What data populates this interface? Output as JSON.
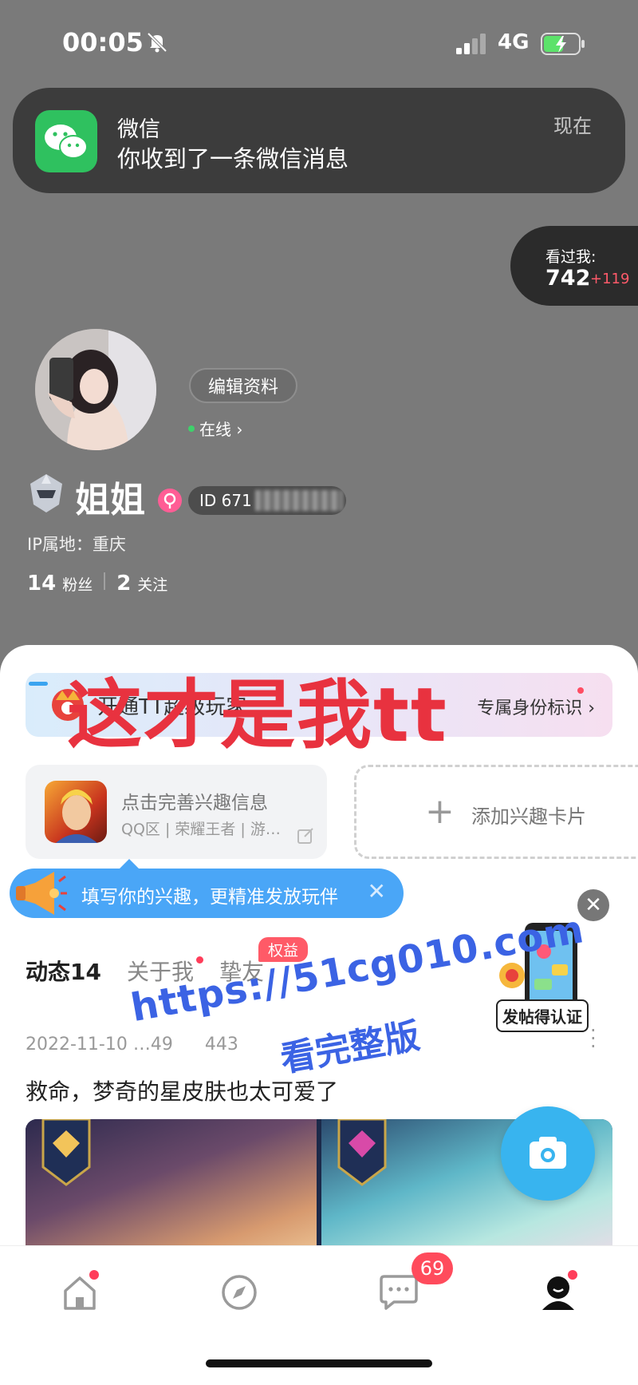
{
  "status_bar": {
    "time": "00:05",
    "network": "4G"
  },
  "notification": {
    "app": "微信",
    "message": "你收到了一条微信消息",
    "time": "现在"
  },
  "visitors": {
    "label": "看过我:",
    "count": "742",
    "delta": "+119"
  },
  "profile": {
    "edit_label": "编辑资料",
    "online_label": "在线 ›",
    "nickname": "姐姐",
    "id_prefix": "ID 671",
    "ip_location": "IP属地：重庆",
    "fans_count": "14",
    "fans_label": "粉丝",
    "following_count": "2",
    "following_label": "关注"
  },
  "banner": {
    "text": "开通TT超级玩家",
    "link": "专属身份标识 ›"
  },
  "overlay_text": {
    "headline": "这才是我tt",
    "url": "https://51cg010.com",
    "sub": "看完整版"
  },
  "interest_card": {
    "title": "点击完善兴趣信息",
    "subtitle": "QQ区 | 荣耀王者 | 游…"
  },
  "add_card": {
    "plus": "+",
    "label": "添加兴趣卡片"
  },
  "tooltip": {
    "text": "填写你的兴趣，更精准发放玩伴",
    "close": "✕"
  },
  "close_button": "✕",
  "tabs": [
    {
      "label": "动态14"
    },
    {
      "label": "关于我"
    },
    {
      "label": "挚友"
    }
  ],
  "rights_badge": "权益",
  "promo": {
    "label": "发帖得认证"
  },
  "post": {
    "date": "2022-11-10 …49",
    "views": "443",
    "title": "救命，梦奇的星皮肤也太可爱了"
  },
  "bottom_nav": {
    "message_badge": "69"
  },
  "icons": [
    "mute-icon",
    "signal-icon",
    "battery-icon",
    "wechat-icon",
    "chevron-right-icon",
    "rank-icon",
    "gender-icon",
    "crown-icon",
    "game-icon",
    "edit-icon",
    "plus-icon",
    "megaphone-icon",
    "close-icon",
    "camera-icon",
    "home-icon",
    "discover-icon",
    "message-icon",
    "profile-icon"
  ],
  "colors": {
    "accent": "#38b4ef",
    "badge_red": "#ff4b5c",
    "watermark_red": "#e8323f",
    "watermark_blue": "#3b63e4",
    "wechat_green": "#2fc15f"
  }
}
